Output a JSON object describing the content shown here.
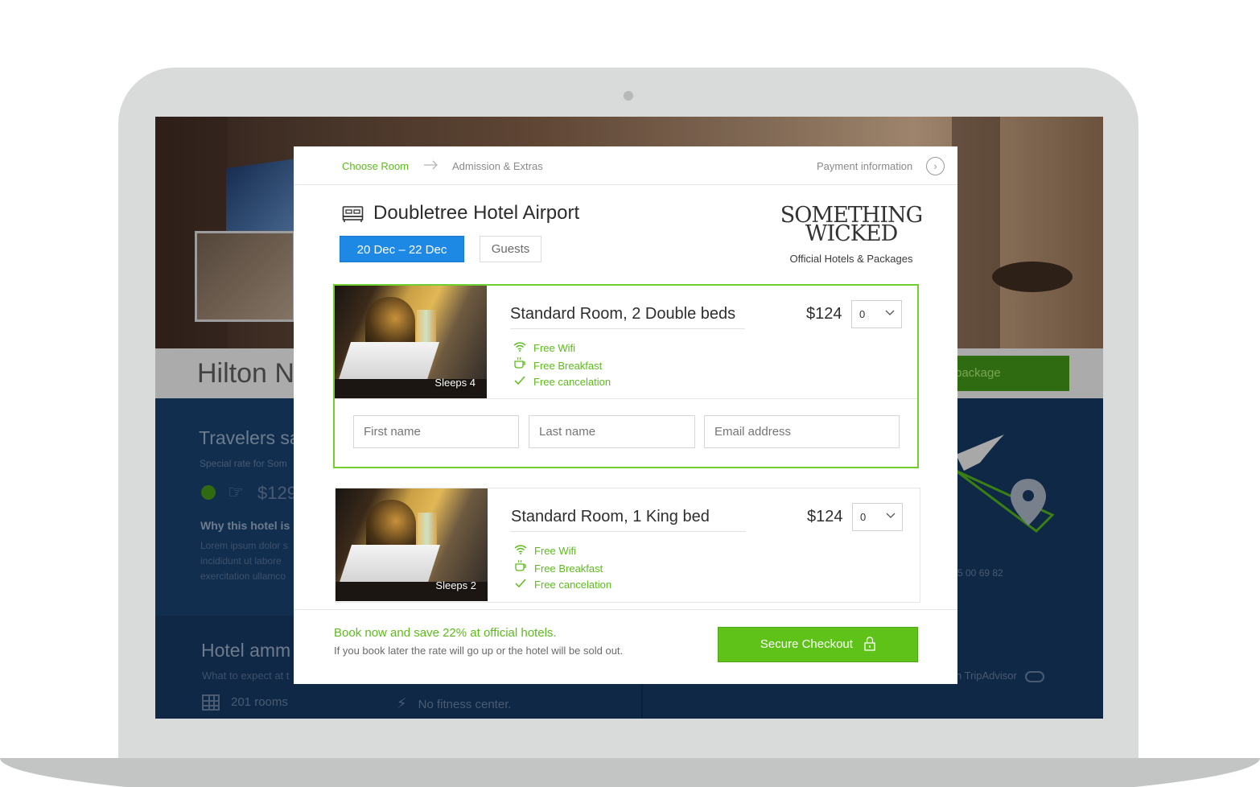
{
  "background_page": {
    "hotel_title": "Hilton N",
    "package_button": "package",
    "travelers_heading": "Travelers sa",
    "special_rate": "Special rate for Som",
    "price": "$129",
    "why_heading": "Why this hotel is",
    "lorem": "Lorem ipsum dolor s incididunt ut labore exercitation ullamco",
    "amenities_heading": "Hotel amm",
    "amenities_sub": "What to expect at t",
    "rooms_count": "201 rooms",
    "fitness": "No fitness center.",
    "phone": "5 00 69 82",
    "tripadvisor": "n TripAdvisor"
  },
  "steps": {
    "step1": "Choose Room",
    "step2": "Admission & Extras",
    "step3": "Payment information"
  },
  "hotel": {
    "name": "Doubletree Hotel Airport",
    "dates": "20 Dec  –  22 Dec",
    "guests_button": "Guests"
  },
  "brand": {
    "logo_line1": "SOMETHING",
    "logo_line2": "WICKED",
    "tagline": "Official Hotels & Packages"
  },
  "rooms": [
    {
      "title": "Standard Room, 2 Double beds",
      "price": "$124",
      "quantity": "0",
      "sleeps": "Sleeps 4",
      "features": [
        "Free Wifi",
        "Free Breakfast",
        "Free cancelation"
      ]
    },
    {
      "title": "Standard Room, 1 King bed",
      "price": "$124",
      "quantity": "0",
      "sleeps": "Sleeps 2",
      "features": [
        "Free Wifi",
        "Free Breakfast",
        "Free cancelation"
      ]
    }
  ],
  "guest_form": {
    "first_name_placeholder": "First name",
    "last_name_placeholder": "Last name",
    "email_placeholder": "Email address"
  },
  "footer": {
    "promo_title": "Book now and save 22% at official hotels.",
    "promo_sub": "If you book later the rate will go up or the hotel will be sold out.",
    "checkout_button": "Secure Checkout"
  },
  "colors": {
    "accent_green": "#5ec219",
    "date_blue": "#1e88e5",
    "background_navy": "#14345a"
  }
}
